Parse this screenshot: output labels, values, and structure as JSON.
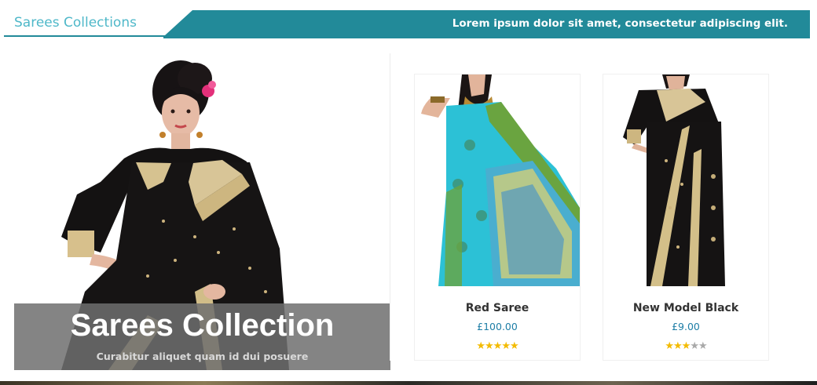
{
  "header": {
    "title": "Sarees Collections",
    "tagline": "Lorem ipsum dolor sit amet, consectetur adipiscing elit.",
    "colors": {
      "teal": "#228a99",
      "title": "#4fb8c9"
    }
  },
  "feature": {
    "title": "Sarees Collection",
    "subtitle": "Curabitur aliquet quam id dui posuere"
  },
  "products": [
    {
      "name": "Red Saree",
      "price": "£100.00",
      "rating": 5,
      "rating_max": 5,
      "image": "turquoise-saree-model"
    },
    {
      "name": "New Model Black",
      "price": "£9.00",
      "rating": 3,
      "rating_max": 5,
      "image": "black-saree-model"
    }
  ],
  "icons": {
    "star_filled": "star-icon",
    "star_empty": "star-empty-icon"
  }
}
